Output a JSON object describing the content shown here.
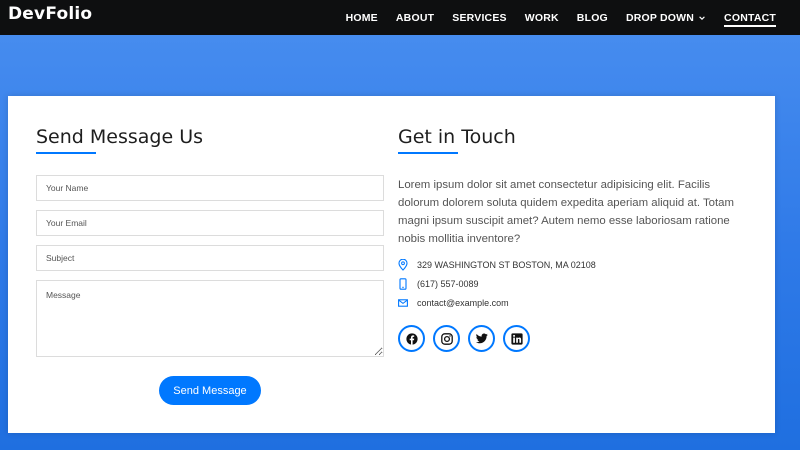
{
  "brand": "DevFolio",
  "nav": {
    "items": [
      {
        "label": "HOME"
      },
      {
        "label": "ABOUT"
      },
      {
        "label": "SERVICES"
      },
      {
        "label": "WORK"
      },
      {
        "label": "BLOG"
      },
      {
        "label": "DROP DOWN"
      },
      {
        "label": "CONTACT"
      }
    ]
  },
  "form": {
    "title": "Send Message Us",
    "name_placeholder": "Your Name",
    "email_placeholder": "Your Email",
    "subject_placeholder": "Subject",
    "message_placeholder": "Message",
    "submit_label": "Send Message"
  },
  "contact": {
    "title": "Get in Touch",
    "description": "Lorem ipsum dolor sit amet consectetur adipisicing elit. Facilis dolorum dolorem soluta quidem expedita aperiam aliquid at. Totam magni ipsum suscipit amet? Autem nemo esse laboriosam ratione nobis mollitia inventore?",
    "address": "329 WASHINGTON ST BOSTON, MA 02108",
    "phone": "(617) 557-0089",
    "email": "contact@example.com"
  },
  "socials": [
    "facebook-icon",
    "instagram-icon",
    "twitter-icon",
    "linkedin-icon"
  ],
  "colors": {
    "accent": "#0078ff",
    "navbar": "#0e0f10",
    "background": "#2f7ae8"
  }
}
